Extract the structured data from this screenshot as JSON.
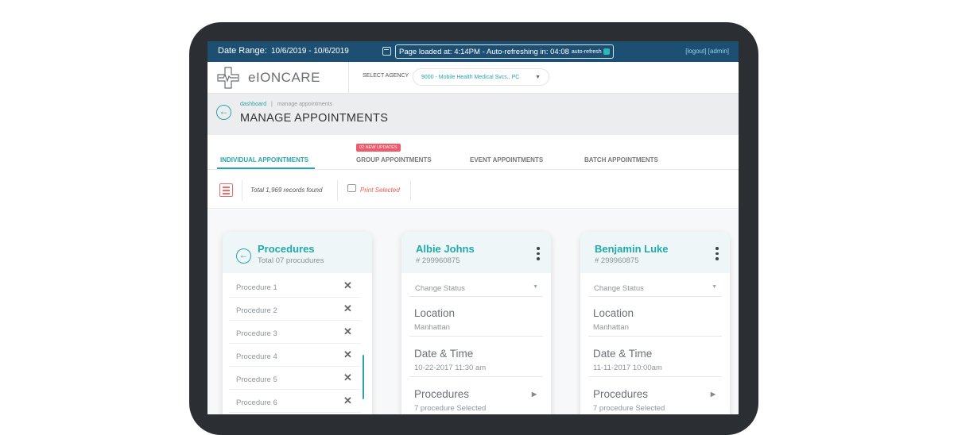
{
  "topbar": {
    "date_range_label": "Date Range:",
    "date_range_value": "10/6/2019  -  10/6/2019",
    "page_loaded": "Page loaded at: 4:14PM - Auto-refreshing in: 04:08",
    "auto_refresh_label": "auto-refresh",
    "links": "[logout] [admin]",
    "calendar_icon": "calendar-icon"
  },
  "header": {
    "logo_text": "eIONCARE",
    "select_agency_label": "SELECT AGENCY",
    "agency_value": "9000 - Mobile Health Medical Svcs., PC"
  },
  "breadcrumb": {
    "home": "dashboard",
    "separator": "|",
    "current": "manage appointments",
    "page_title": "MANAGE APPOINTMENTS"
  },
  "tabs": [
    {
      "label": "INDIVIDUAL APPOINTMENTS",
      "active": true
    },
    {
      "label": "GROUP APPOINTMENTS",
      "badge": "02 NEW UPDATES"
    },
    {
      "label": "EVENT APPOINTMENTS"
    },
    {
      "label": "BATCH APPOINTMENTS"
    }
  ],
  "toolbar": {
    "records": "Total 1,969 records found",
    "print": "Print Selected"
  },
  "procedures_card": {
    "title": "Procedures",
    "subtitle": "Total 07 procudures",
    "items": [
      "Procedure 1",
      "Procedure 2",
      "Procedure 3",
      "Procedure 4",
      "Procedure 5",
      "Procedure 6"
    ]
  },
  "patients": [
    {
      "name": "Albie Johns",
      "id": "# 299960875",
      "status": "Change Status",
      "location_label": "Location",
      "location": "Manhattan",
      "datetime_label": "Date & Time",
      "datetime": "10-22-2017  11:30 am",
      "procedures_label": "Procedures",
      "procedures": "7 procedure Selected"
    },
    {
      "name": "Benjamin Luke",
      "id": "# 299960875",
      "status": "Change Status",
      "location_label": "Location",
      "location": "Manhattan",
      "datetime_label": "Date & Time",
      "datetime": "11-11-2017  10:00am",
      "procedures_label": "Procedures",
      "procedures": "7 procedure Selected"
    }
  ],
  "colors": {
    "accent": "#2aa5a9",
    "topbar": "#1d4f73",
    "alert": "#f05a6b"
  }
}
